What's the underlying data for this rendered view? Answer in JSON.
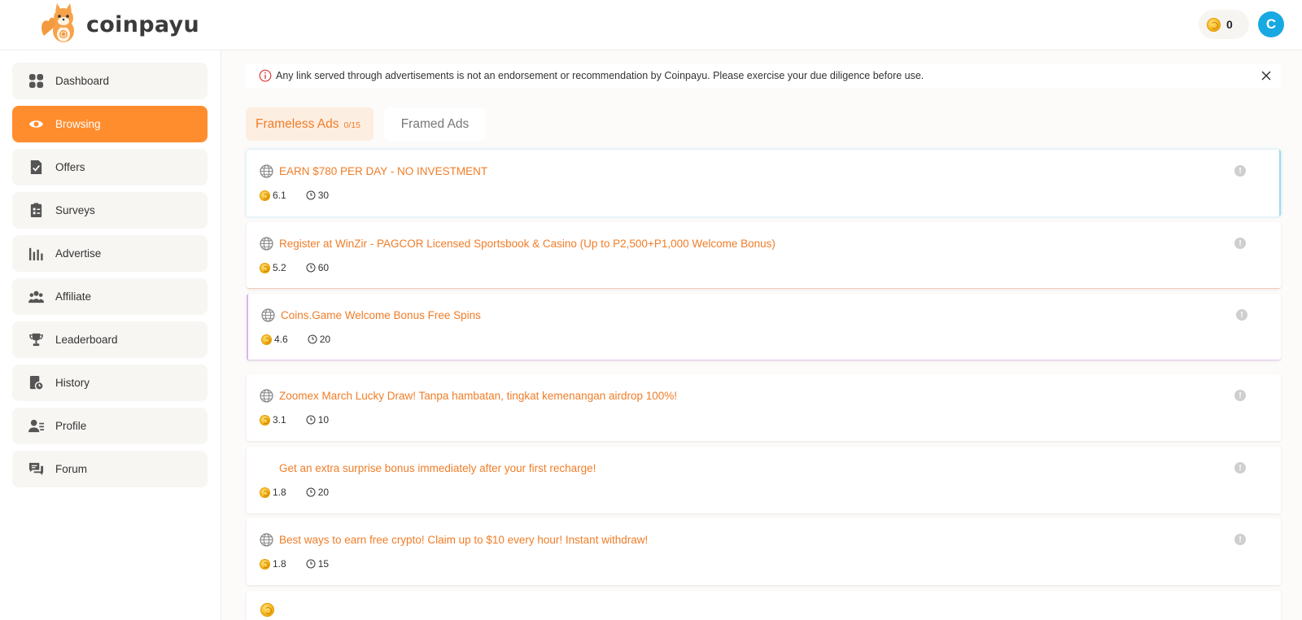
{
  "header": {
    "logo_text": "coinpayu",
    "balance": "0",
    "avatar_initial": "C"
  },
  "colors": {
    "accent": "#ff8d2e",
    "ad_title": "#f07d28",
    "avatar": "#18a9e3"
  },
  "sidebar": {
    "items": [
      {
        "label": "Dashboard",
        "icon": "dashboard-icon",
        "active": false
      },
      {
        "label": "Browsing",
        "icon": "eye-icon",
        "active": true
      },
      {
        "label": "Offers",
        "icon": "offers-icon",
        "active": false
      },
      {
        "label": "Surveys",
        "icon": "clipboard-icon",
        "active": false
      },
      {
        "label": "Advertise",
        "icon": "bar-chart-icon",
        "active": false
      },
      {
        "label": "Affiliate",
        "icon": "users-icon",
        "active": false
      },
      {
        "label": "Leaderboard",
        "icon": "trophy-icon",
        "active": false
      },
      {
        "label": "History",
        "icon": "history-icon",
        "active": false
      },
      {
        "label": "Profile",
        "icon": "profile-icon",
        "active": false
      },
      {
        "label": "Forum",
        "icon": "chat-icon",
        "active": false
      }
    ]
  },
  "notice": {
    "text": "Any link served through advertisements is not an endorsement or recommendation by Coinpayu. Please exercise your due diligence before use."
  },
  "tabs": [
    {
      "label": "Frameless Ads",
      "count": "0/15",
      "active": true
    },
    {
      "label": "Framed Ads",
      "active": false
    }
  ],
  "ads": [
    {
      "title": "EARN $780 PER DAY - NO INVESTMENT",
      "reward": "6.1",
      "duration": "30",
      "icon": "globe-icon"
    },
    {
      "title": "Register at WinZir - PAGCOR Licensed Sportsbook & Casino (Up to P2,500+P1,000 Welcome Bonus)",
      "reward": "5.2",
      "duration": "60",
      "icon": "globe-icon"
    },
    {
      "title": "Coins.Game Welcome Bonus Free Spins",
      "reward": "4.6",
      "duration": "20",
      "icon": "globe-icon"
    },
    {
      "title": "Zoomex March Lucky Draw! Tanpa hambatan, tingkat kemenangan airdrop 100%!",
      "reward": "3.1",
      "duration": "10",
      "icon": "globe-icon"
    },
    {
      "title": "Get an extra surprise bonus immediately after your first recharge!",
      "reward": "1.8",
      "duration": "20",
      "icon": ""
    },
    {
      "title": "Best ways to earn free crypto! Claim up to $10 every hour! Instant withdraw!",
      "reward": "1.8",
      "duration": "15",
      "icon": "globe-icon"
    }
  ]
}
